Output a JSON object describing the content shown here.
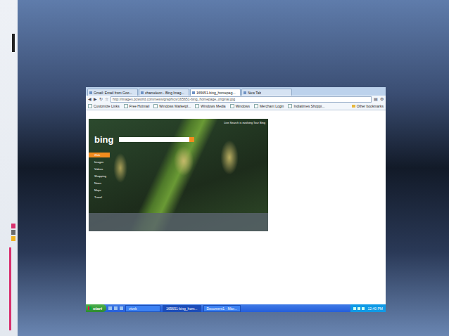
{
  "browser": {
    "tabs": [
      {
        "label": "Gmail: Email from Goo...",
        "selected": false
      },
      {
        "label": "chameleon - Bing Imag...",
        "selected": false
      },
      {
        "label": "165651-bing_homepag...",
        "selected": true
      },
      {
        "label": "New Tab",
        "selected": false
      }
    ],
    "address": "http://images.pcworld.com/news/graphics/165651-bing_homepage_original.jpg",
    "bookmarks": [
      "Customize Links",
      "Free Hotmail",
      "Windows Marketpl...",
      "Windows Media",
      "Windows",
      "Merchant Login",
      "Indiatimes Shoppi..."
    ],
    "other_bookmarks": "Other bookmarks"
  },
  "page": {
    "logo": "bing",
    "notice": "Live Search is evolving  Tour Bing",
    "nav": [
      {
        "label": "Web",
        "selected": true
      },
      {
        "label": "Images",
        "selected": false
      },
      {
        "label": "Videos",
        "selected": false
      },
      {
        "label": "Shopping",
        "selected": false
      },
      {
        "label": "News",
        "selected": false
      },
      {
        "label": "Maps",
        "selected": false
      },
      {
        "label": "Travel",
        "selected": false
      }
    ]
  },
  "taskbar": {
    "start": "start",
    "items": [
      {
        "label": "vivek",
        "selected": false
      },
      {
        "label": "165651-bing_hom...",
        "selected": true
      },
      {
        "label": "Document1 - Micr...",
        "selected": false
      }
    ],
    "clock": "12:40 PM"
  }
}
